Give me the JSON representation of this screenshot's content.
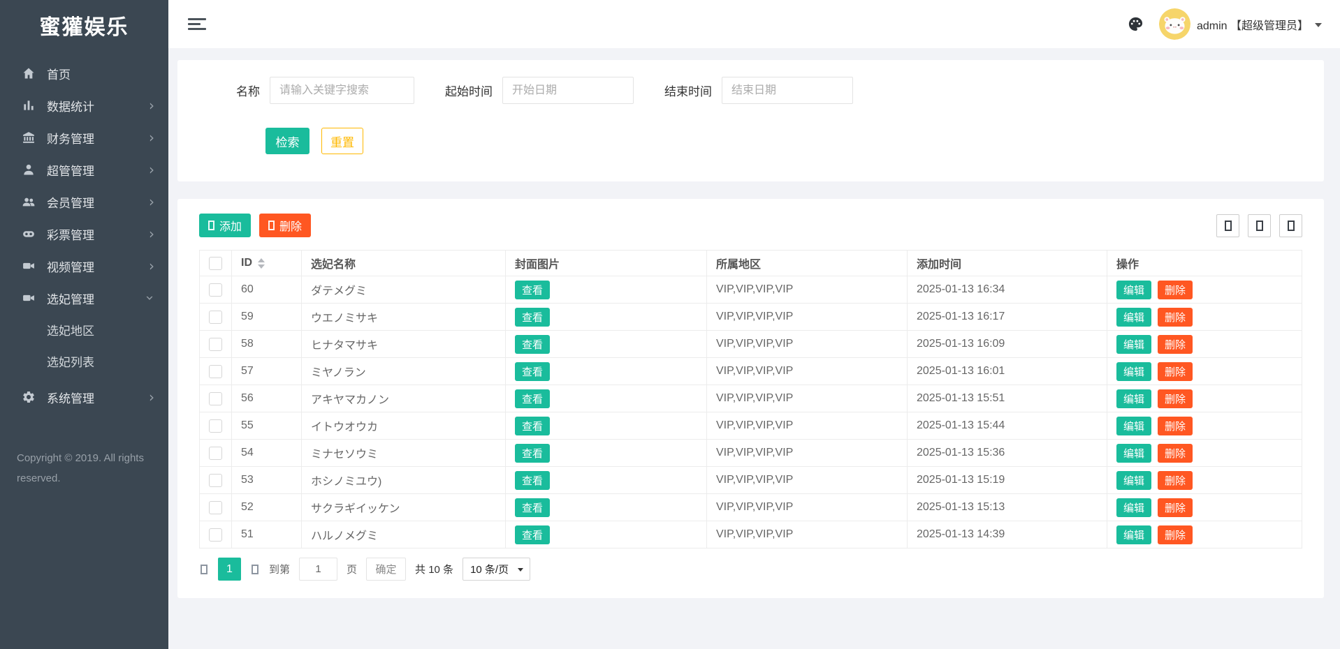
{
  "app": {
    "title": "蜜獾娱乐"
  },
  "topbar": {
    "username": "admin 【超级管理员】"
  },
  "sidebar": {
    "items": [
      {
        "label": "首页"
      },
      {
        "label": "数据统计"
      },
      {
        "label": "财务管理"
      },
      {
        "label": "超管管理"
      },
      {
        "label": "会员管理"
      },
      {
        "label": "彩票管理"
      },
      {
        "label": "视频管理"
      },
      {
        "label": "选妃管理"
      },
      {
        "label": "系统管理"
      }
    ],
    "submenu": [
      {
        "label": "选妃地区"
      },
      {
        "label": "选妃列表"
      }
    ],
    "copyright": "Copyright © 2019. All rights reserved."
  },
  "filters": {
    "name_label": "名称",
    "name_placeholder": "请输入关键字搜索",
    "start_label": "起始时间",
    "start_placeholder": "开始日期",
    "end_label": "结束时间",
    "end_placeholder": "结束日期",
    "search_button": "检索",
    "reset_button": "重置"
  },
  "toolbar": {
    "add_button": "添加",
    "delete_button": "删除"
  },
  "table": {
    "headers": {
      "id": "ID",
      "name": "选妃名称",
      "cover": "封面图片",
      "region": "所属地区",
      "time": "添加时间",
      "action": "操作"
    },
    "view_button": "查看",
    "edit_button": "编辑",
    "delete_button": "删除",
    "rows": [
      {
        "id": "60",
        "name": "ダテメグミ",
        "region": "VIP,VIP,VIP,VIP",
        "time": "2025-01-13 16:34"
      },
      {
        "id": "59",
        "name": "ウエノミサキ",
        "region": "VIP,VIP,VIP,VIP",
        "time": "2025-01-13 16:17"
      },
      {
        "id": "58",
        "name": "ヒナタマサキ",
        "region": "VIP,VIP,VIP,VIP",
        "time": "2025-01-13 16:09"
      },
      {
        "id": "57",
        "name": "ミヤノラン",
        "region": "VIP,VIP,VIP,VIP",
        "time": "2025-01-13 16:01"
      },
      {
        "id": "56",
        "name": "アキヤマカノン",
        "region": "VIP,VIP,VIP,VIP",
        "time": "2025-01-13 15:51"
      },
      {
        "id": "55",
        "name": "イトウオウカ",
        "region": "VIP,VIP,VIP,VIP",
        "time": "2025-01-13 15:44"
      },
      {
        "id": "54",
        "name": "ミナセソウミ",
        "region": "VIP,VIP,VIP,VIP",
        "time": "2025-01-13 15:36"
      },
      {
        "id": "53",
        "name": "ホシノミユウ)",
        "region": "VIP,VIP,VIP,VIP",
        "time": "2025-01-13 15:19"
      },
      {
        "id": "52",
        "name": "サクラギイッケン",
        "region": "VIP,VIP,VIP,VIP",
        "time": "2025-01-13 15:13"
      },
      {
        "id": "51",
        "name": "ハルノメグミ",
        "region": "VIP,VIP,VIP,VIP",
        "time": "2025-01-13 14:39"
      }
    ]
  },
  "pagination": {
    "current_page": "1",
    "goto_label": "到第",
    "goto_value": "1",
    "page_label": "页",
    "confirm_button": "确定",
    "total_text": "共 10 条",
    "per_page": "10 条/页"
  },
  "colors": {
    "accent_teal": "#1abc9c",
    "danger_orange": "#ff5722",
    "warning_amber": "#ffb800",
    "sidebar_bg": "#3b4752"
  }
}
